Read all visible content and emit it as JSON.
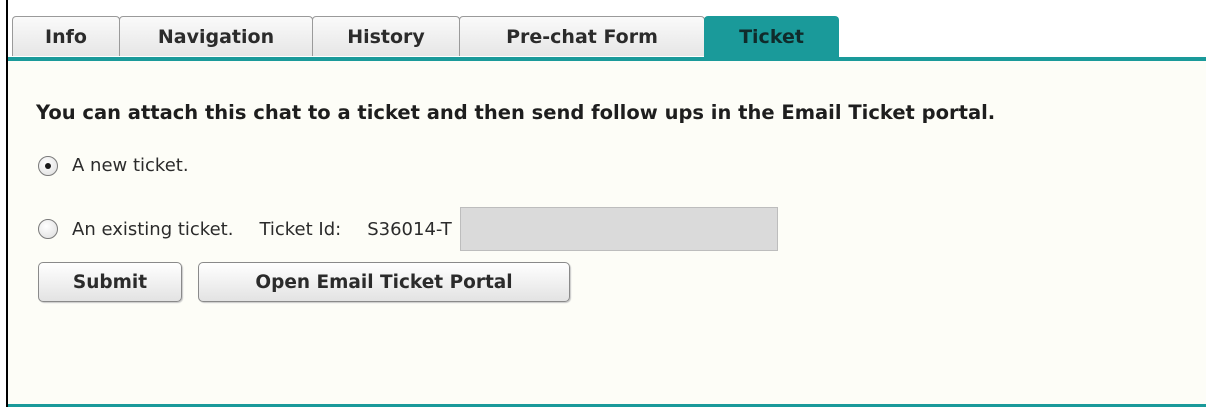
{
  "tabs": [
    {
      "label": "Info"
    },
    {
      "label": "Navigation"
    },
    {
      "label": "History"
    },
    {
      "label": "Pre-chat Form"
    },
    {
      "label": "Ticket",
      "active": true
    }
  ],
  "ticket_panel": {
    "intro": "You can attach this chat to a ticket and then send follow ups in the Email Ticket portal.",
    "option_new": "A new ticket.",
    "option_existing": "An existing ticket.",
    "ticket_id_label": "Ticket Id:",
    "ticket_id_prefix": "S36014-T",
    "ticket_id_value": "",
    "selected_option": "new",
    "submit_label": "Submit",
    "portal_label": "Open Email Ticket Portal"
  },
  "colors": {
    "accent": "#1a9a9a",
    "panel_background": "#fdfdf7",
    "input_background": "#dadada"
  }
}
